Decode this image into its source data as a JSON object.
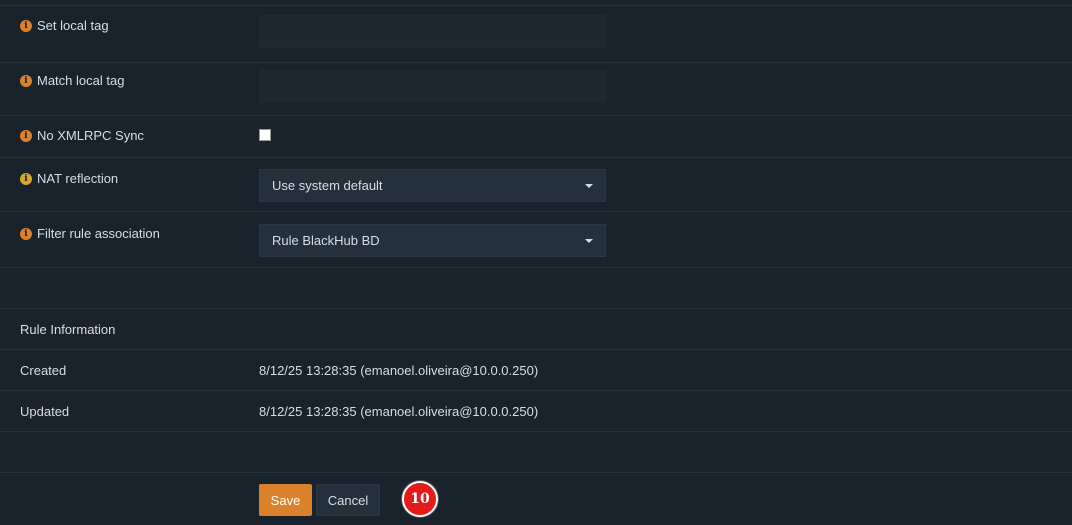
{
  "form": {
    "set_local_tag": {
      "label": "Set local tag",
      "value": ""
    },
    "match_local_tag": {
      "label": "Match local tag",
      "value": ""
    },
    "no_xmlrpc_sync": {
      "label": "No XMLRPC Sync",
      "checked": false
    },
    "nat_reflection": {
      "label": "NAT reflection",
      "selected": "Use system default"
    },
    "filter_rule_association": {
      "label": "Filter rule association",
      "selected": "Rule BlackHub BD"
    }
  },
  "rule_info": {
    "heading": "Rule Information",
    "created_label": "Created",
    "created_value": "8/12/25 13:28:35 (emanoel.oliveira@10.0.0.250)",
    "updated_label": "Updated",
    "updated_value": "8/12/25 13:28:35 (emanoel.oliveira@10.0.0.250)"
  },
  "buttons": {
    "save": "Save",
    "cancel": "Cancel"
  },
  "badge": {
    "number": "10"
  },
  "icons": {
    "info": "info-icon",
    "dropdown": "chevron-down-icon"
  },
  "colors": {
    "background": "#1a232b",
    "accent": "#d9822b",
    "badge": "#e31b1b"
  }
}
